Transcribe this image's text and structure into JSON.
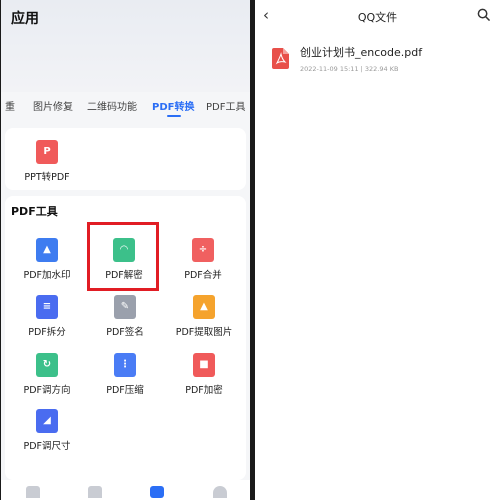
{
  "left": {
    "app_title": "应用",
    "tabs": [
      {
        "label": "重"
      },
      {
        "label": "图片修复"
      },
      {
        "label": "二维码功能"
      },
      {
        "label": "PDF转换",
        "active": true
      },
      {
        "label": "PDF工具"
      }
    ],
    "top_tool": {
      "label": "PPT转PDF",
      "icon": "ppt-to-pdf-icon",
      "color": "#f05a5a"
    },
    "section_title": "PDF工具",
    "tools": [
      {
        "label": "PDF加水印",
        "icon": "watermark-icon",
        "color": "#3e7cf0"
      },
      {
        "label": "PDF解密",
        "icon": "unlock-icon",
        "color": "#3cc08a"
      },
      {
        "label": "PDF合并",
        "icon": "merge-icon",
        "color": "#f06060"
      },
      {
        "label": "PDF拆分",
        "icon": "split-icon",
        "color": "#4a6cf0"
      },
      {
        "label": "PDF签名",
        "icon": "signature-icon",
        "color": "#9aa0ac"
      },
      {
        "label": "PDF提取图片",
        "icon": "extract-image-icon",
        "color": "#f5a32d"
      },
      {
        "label": "PDF调方向",
        "icon": "rotate-icon",
        "color": "#3cc08a"
      },
      {
        "label": "PDF压缩",
        "icon": "compress-icon",
        "color": "#4a7cf5"
      },
      {
        "label": "PDF加密",
        "icon": "lock-icon",
        "color": "#f05a5a"
      },
      {
        "label": "PDF调尺寸",
        "icon": "resize-icon",
        "color": "#4a6cf0"
      }
    ],
    "highlight_color": "#e11d24",
    "accent_color": "#2b6ef5"
  },
  "right": {
    "title": "QQ文件",
    "files": [
      {
        "name": "创业计划书_encode.pdf",
        "meta": "2022-11-09 15:11 | 322.94 KB",
        "icon": "pdf-file-icon",
        "color": "#e8504a"
      }
    ]
  }
}
